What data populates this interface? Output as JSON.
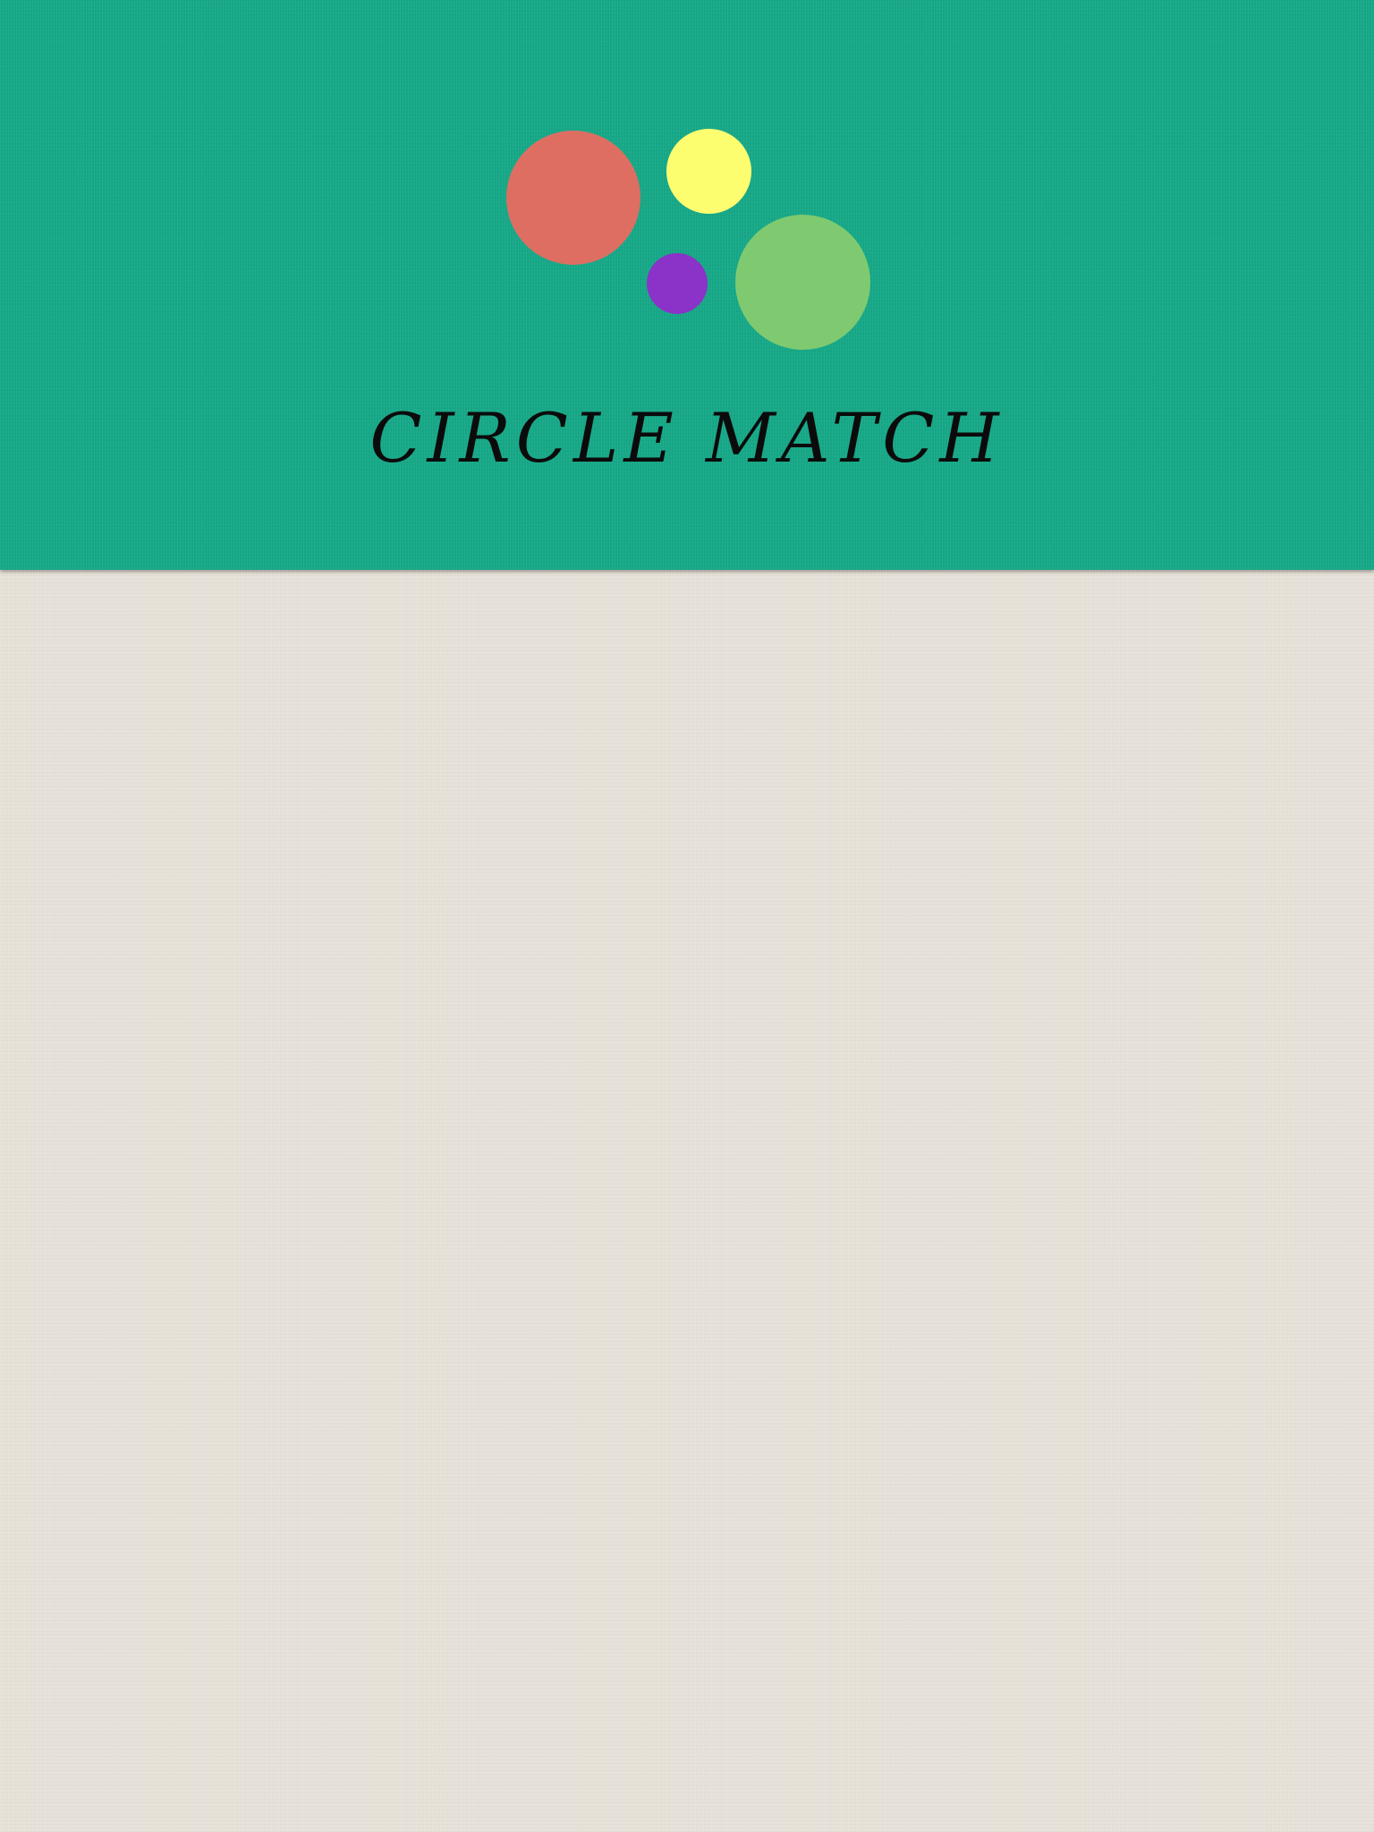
{
  "game": {
    "title": "CIRCLE MATCH"
  },
  "logo": {
    "circles": [
      {
        "name": "red-circle",
        "color": "#df6e62"
      },
      {
        "name": "yellow-circle",
        "color": "#fdfd70"
      },
      {
        "name": "purple-circle",
        "color": "#8b32c8"
      },
      {
        "name": "green-circle",
        "color": "#7fca70"
      }
    ]
  },
  "colors": {
    "header_bg": "#16a887",
    "board_bg": "#e6e1d8",
    "title_text": "#0b0b0b"
  }
}
